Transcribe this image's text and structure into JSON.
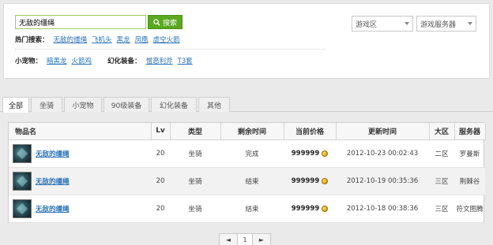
{
  "search": {
    "value": "无敌的缰绳",
    "button_label": "搜索"
  },
  "hot_search": {
    "label": "热门搜索：",
    "links": [
      "无敌的缰绳",
      "飞机头",
      "黑龙",
      "凤凰",
      "虚空火箭"
    ]
  },
  "pets": {
    "label": "小宠物：",
    "links": [
      "暗黑龙",
      "火箭鸡"
    ]
  },
  "transmog": {
    "label": "幻化装备：",
    "links": [
      "憎恶利斧",
      "T3套"
    ]
  },
  "filters": {
    "zone": "游戏区",
    "server": "游戏服务器"
  },
  "tabs": [
    "全部",
    "坐骑",
    "小宠物",
    "90级装备",
    "幻化装备",
    "其他"
  ],
  "table": {
    "headers": [
      "物品名",
      "Lv",
      "类型",
      "剩余时间",
      "当前价格",
      "更新时间",
      "大区",
      "服务器"
    ],
    "rows": [
      {
        "name": "无敌的缰绳",
        "lv": "20",
        "type": "坐骑",
        "remaining": "完成",
        "price": "999999",
        "updated": "2012-10-23 00:02:43",
        "zone": "二区",
        "server": "罗曼斯"
      },
      {
        "name": "无敌的缰绳",
        "lv": "20",
        "type": "坐骑",
        "remaining": "结束",
        "price": "999999",
        "updated": "2012-10-19 00:35:36",
        "zone": "三区",
        "server": "荆棘谷"
      },
      {
        "name": "无敌的缰绳",
        "lv": "20",
        "type": "坐骑",
        "remaining": "结束",
        "price": "999999",
        "updated": "2012-10-18 00:38:36",
        "zone": "三区",
        "server": "符文图腾"
      }
    ]
  },
  "pager": {
    "prev": "◄",
    "page": "1",
    "next": "►"
  },
  "colors": {
    "accent": "#5aa820",
    "link": "#2a73b8"
  }
}
